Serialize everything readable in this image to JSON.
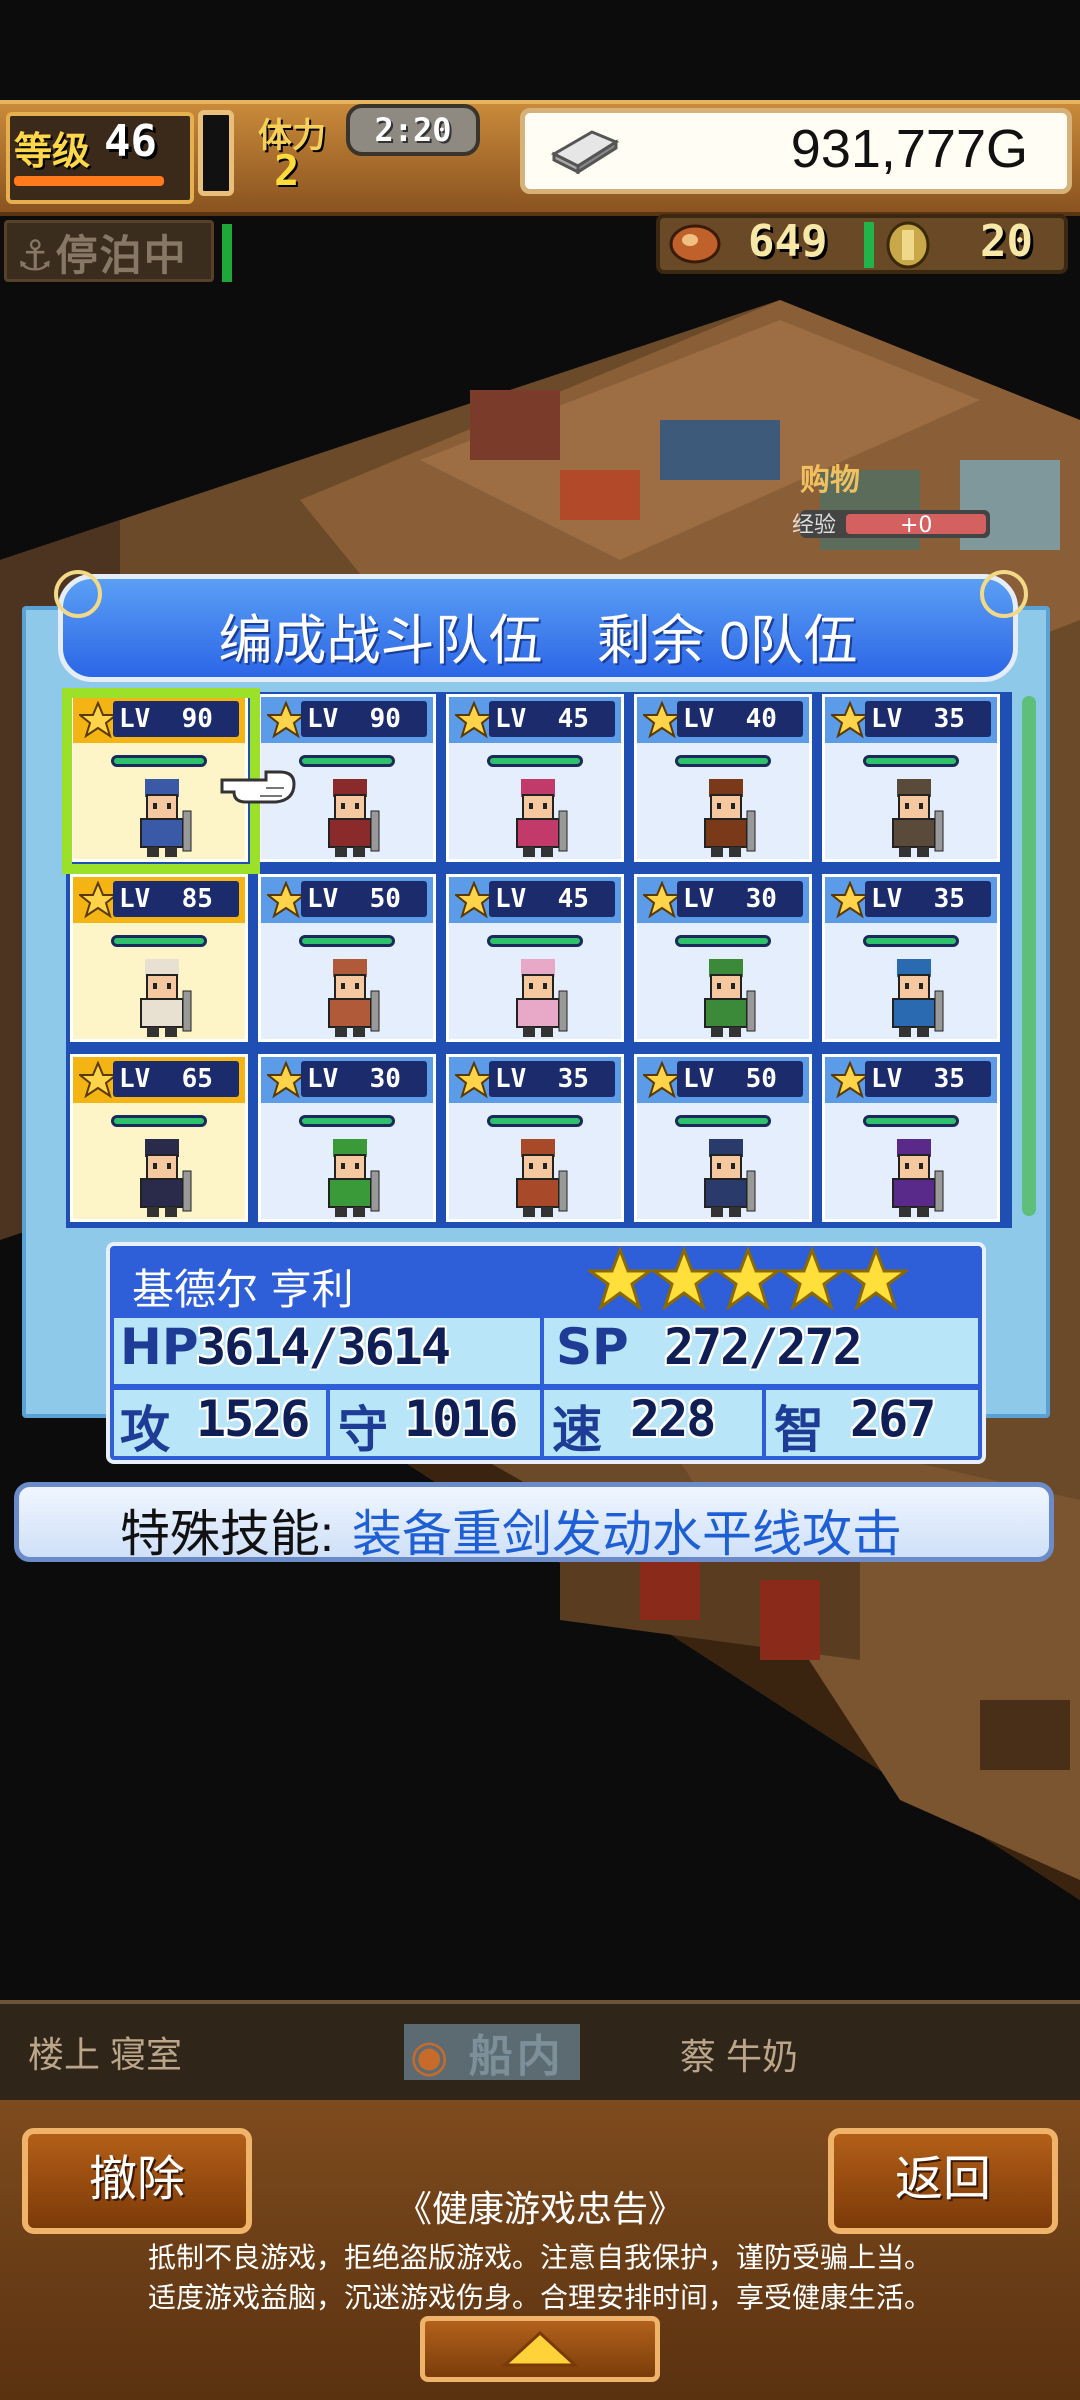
{
  "hud": {
    "level_label": "等级",
    "level": "46",
    "stamina_label": "体力",
    "stamina": "2",
    "timer": "2:20",
    "money": "931,777G",
    "status": "停泊中",
    "resource1": "649",
    "resource2": "20"
  },
  "panel": {
    "title": "编成战斗队伍　剩余 0队伍"
  },
  "party": [
    {
      "lv": "90",
      "highlight": true
    },
    {
      "lv": "90",
      "highlight": false
    },
    {
      "lv": "45",
      "highlight": false
    },
    {
      "lv": "40",
      "highlight": false
    },
    {
      "lv": "35",
      "highlight": false
    },
    {
      "lv": "85",
      "highlight": true
    },
    {
      "lv": "50",
      "highlight": false
    },
    {
      "lv": "45",
      "highlight": false
    },
    {
      "lv": "30",
      "highlight": false
    },
    {
      "lv": "35",
      "highlight": false
    },
    {
      "lv": "65",
      "highlight": true
    },
    {
      "lv": "30",
      "highlight": false
    },
    {
      "lv": "35",
      "highlight": false
    },
    {
      "lv": "50",
      "highlight": false
    },
    {
      "lv": "35",
      "highlight": false
    }
  ],
  "lv_prefix": "LV",
  "selected": {
    "name": "基德尔 亨利",
    "stars": 5,
    "hp_label": "HP",
    "hp": "3614/3614",
    "sp_label": "SP",
    "sp": "272/272",
    "atk_label": "攻",
    "atk": "1526",
    "def_label": "守",
    "def": "1016",
    "spd_label": "速",
    "spd": "228",
    "int_label": "智",
    "int": "267"
  },
  "skill": {
    "label": "特殊技能:",
    "text": "装备重剑发动水平线攻击"
  },
  "location": {
    "left": "楼上 寝室",
    "center": "船内",
    "right": "蔡 牛奶"
  },
  "buttons": {
    "remove": "撤除",
    "back": "返回"
  },
  "notice": {
    "title": "《健康游戏忠告》",
    "line1": "抵制不良游戏，拒绝盗版游戏。注意自我保护，谨防受骗上当。",
    "line2": "适度游戏益脑，沉迷游戏伤身。合理安排时间，享受健康生活。"
  },
  "colors": {
    "panel_blue": "#2e5ed8",
    "highlight_gold": "#f3b414",
    "select_green": "#9be12a"
  }
}
